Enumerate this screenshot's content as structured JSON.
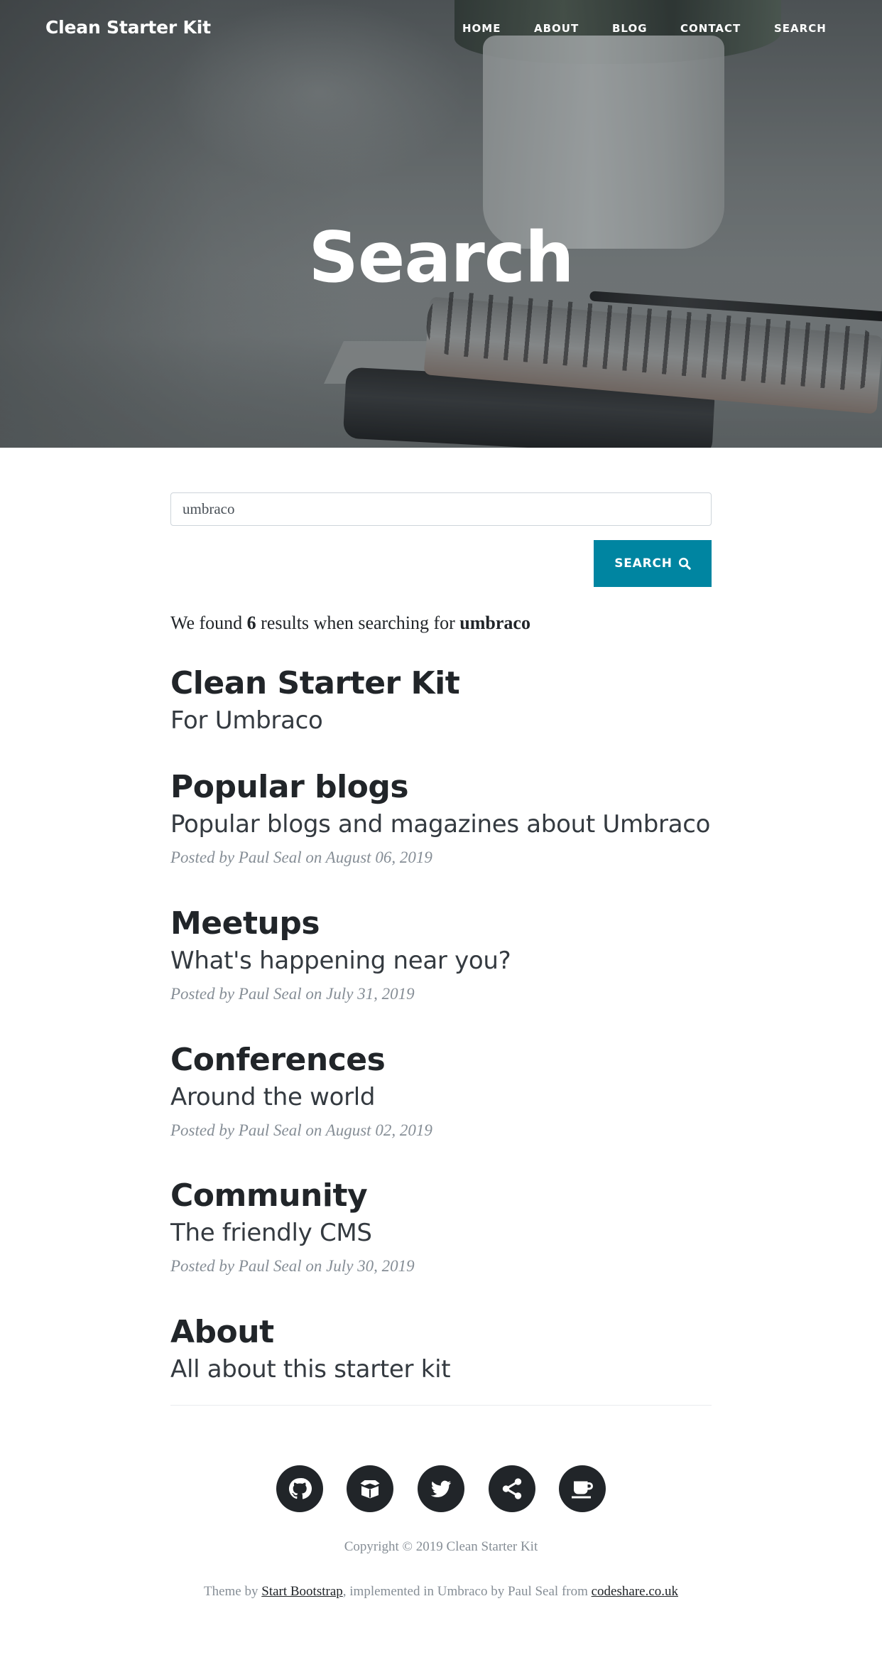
{
  "brand": "Clean Starter Kit",
  "nav": [
    {
      "label": "HOME"
    },
    {
      "label": "ABOUT"
    },
    {
      "label": "BLOG"
    },
    {
      "label": "CONTACT"
    },
    {
      "label": "SEARCH"
    }
  ],
  "hero": {
    "title": "Search"
  },
  "search": {
    "value": "umbraco",
    "button_label": "SEARCH",
    "button_icon": "search-icon"
  },
  "summary": {
    "prefix": "We found",
    "count": "6",
    "middle": "results when searching for",
    "term": "umbraco"
  },
  "results": [
    {
      "title": "Clean Starter Kit",
      "subtitle": "For Umbraco",
      "meta": ""
    },
    {
      "title": "Popular blogs",
      "subtitle": "Popular blogs and magazines about Umbraco",
      "meta": "Posted by Paul Seal on August 06, 2019"
    },
    {
      "title": "Meetups",
      "subtitle": "What's happening near you?",
      "meta": "Posted by Paul Seal on July 31, 2019"
    },
    {
      "title": "Conferences",
      "subtitle": "Around the world",
      "meta": "Posted by Paul Seal on August 02, 2019"
    },
    {
      "title": "Community",
      "subtitle": "The friendly CMS",
      "meta": "Posted by Paul Seal on July 30, 2019"
    },
    {
      "title": "About",
      "subtitle": "All about this starter kit",
      "meta": ""
    }
  ],
  "social": [
    {
      "icon": "github-icon"
    },
    {
      "icon": "package-icon"
    },
    {
      "icon": "twitter-icon"
    },
    {
      "icon": "share-icon"
    },
    {
      "icon": "coffee-icon"
    }
  ],
  "footer": {
    "copyright": "Copyright © 2019 Clean Starter Kit",
    "theme_prefix": "Theme by",
    "theme_link": "Start Bootstrap",
    "middle": ", implemented in Umbraco by Paul Seal from",
    "site_link": "codeshare.co.uk"
  },
  "colors": {
    "accent": "#0085a1",
    "text": "#212529",
    "muted": "#868e96"
  }
}
